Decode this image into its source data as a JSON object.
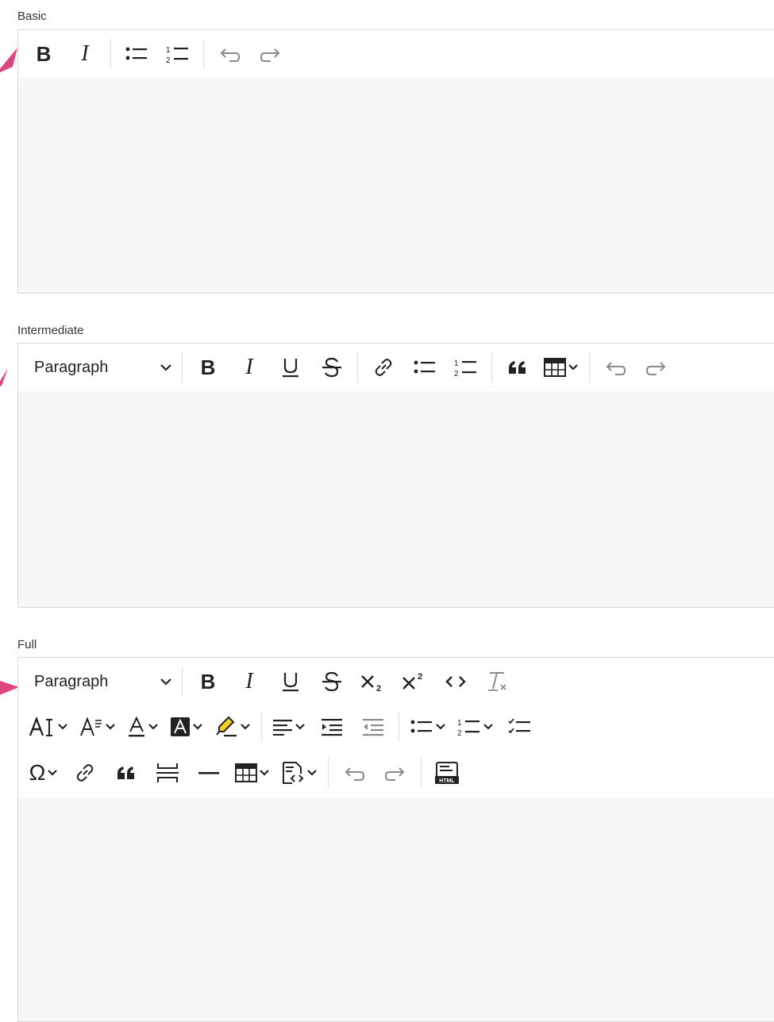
{
  "sections": {
    "basic": {
      "label": "Basic"
    },
    "intermediate": {
      "label": "Intermediate",
      "block_format": "Paragraph"
    },
    "full": {
      "label": "Full",
      "block_format": "Paragraph"
    }
  },
  "colors": {
    "pointer_arrow": "#e0447f",
    "toolbar_bg": "#ffffff",
    "editor_bg": "#f7f7f7",
    "border": "#d8d8d8",
    "disabled_icon": "#8a8a8a"
  },
  "icons": {
    "basic": [
      "bold-icon",
      "italic-icon",
      "bulleted-list-icon",
      "numbered-list-icon",
      "undo-icon",
      "redo-icon"
    ],
    "intermediate": [
      "bold-icon",
      "italic-icon",
      "underline-icon",
      "strikethrough-icon",
      "link-icon",
      "bulleted-list-icon",
      "numbered-list-icon",
      "block-quote-icon",
      "table-icon",
      "undo-icon",
      "redo-icon"
    ],
    "full": [
      "bold-icon",
      "italic-icon",
      "underline-icon",
      "strikethrough-icon",
      "subscript-icon",
      "superscript-icon",
      "code-icon",
      "remove-format-icon",
      "font-size-icon",
      "font-family-icon",
      "font-color-icon",
      "font-background-color-icon",
      "highlight-icon",
      "alignment-icon",
      "indent-icon",
      "outdent-icon",
      "bulleted-list-icon",
      "numbered-list-icon",
      "todo-list-icon",
      "special-characters-icon",
      "link-icon",
      "block-quote-icon",
      "page-break-icon",
      "horizontal-line-icon",
      "table-icon",
      "html-embed-icon",
      "undo-icon",
      "redo-icon",
      "source-editing-icon"
    ]
  }
}
